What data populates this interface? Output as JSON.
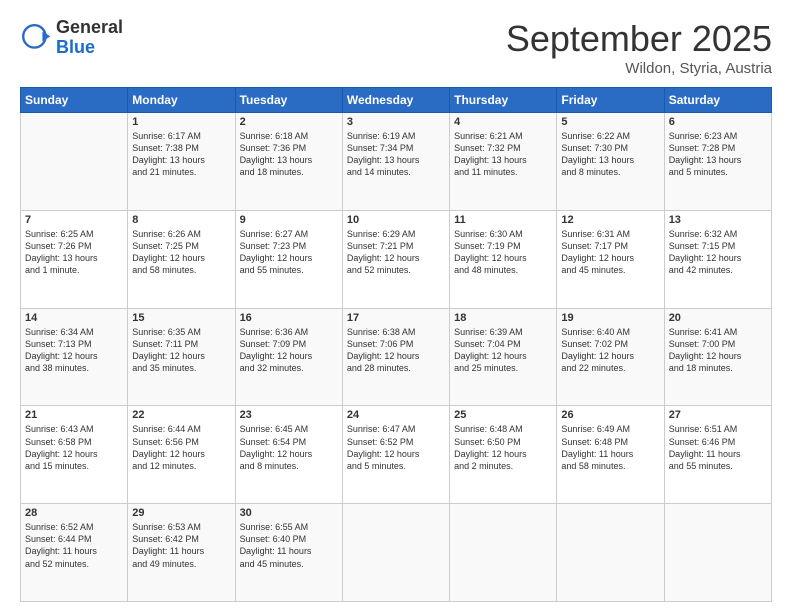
{
  "header": {
    "logo_general": "General",
    "logo_blue": "Blue",
    "month": "September 2025",
    "location": "Wildon, Styria, Austria"
  },
  "days_of_week": [
    "Sunday",
    "Monday",
    "Tuesday",
    "Wednesday",
    "Thursday",
    "Friday",
    "Saturday"
  ],
  "weeks": [
    [
      {
        "day": "",
        "info": ""
      },
      {
        "day": "1",
        "info": "Sunrise: 6:17 AM\nSunset: 7:38 PM\nDaylight: 13 hours\nand 21 minutes."
      },
      {
        "day": "2",
        "info": "Sunrise: 6:18 AM\nSunset: 7:36 PM\nDaylight: 13 hours\nand 18 minutes."
      },
      {
        "day": "3",
        "info": "Sunrise: 6:19 AM\nSunset: 7:34 PM\nDaylight: 13 hours\nand 14 minutes."
      },
      {
        "day": "4",
        "info": "Sunrise: 6:21 AM\nSunset: 7:32 PM\nDaylight: 13 hours\nand 11 minutes."
      },
      {
        "day": "5",
        "info": "Sunrise: 6:22 AM\nSunset: 7:30 PM\nDaylight: 13 hours\nand 8 minutes."
      },
      {
        "day": "6",
        "info": "Sunrise: 6:23 AM\nSunset: 7:28 PM\nDaylight: 13 hours\nand 5 minutes."
      }
    ],
    [
      {
        "day": "7",
        "info": "Sunrise: 6:25 AM\nSunset: 7:26 PM\nDaylight: 13 hours\nand 1 minute."
      },
      {
        "day": "8",
        "info": "Sunrise: 6:26 AM\nSunset: 7:25 PM\nDaylight: 12 hours\nand 58 minutes."
      },
      {
        "day": "9",
        "info": "Sunrise: 6:27 AM\nSunset: 7:23 PM\nDaylight: 12 hours\nand 55 minutes."
      },
      {
        "day": "10",
        "info": "Sunrise: 6:29 AM\nSunset: 7:21 PM\nDaylight: 12 hours\nand 52 minutes."
      },
      {
        "day": "11",
        "info": "Sunrise: 6:30 AM\nSunset: 7:19 PM\nDaylight: 12 hours\nand 48 minutes."
      },
      {
        "day": "12",
        "info": "Sunrise: 6:31 AM\nSunset: 7:17 PM\nDaylight: 12 hours\nand 45 minutes."
      },
      {
        "day": "13",
        "info": "Sunrise: 6:32 AM\nSunset: 7:15 PM\nDaylight: 12 hours\nand 42 minutes."
      }
    ],
    [
      {
        "day": "14",
        "info": "Sunrise: 6:34 AM\nSunset: 7:13 PM\nDaylight: 12 hours\nand 38 minutes."
      },
      {
        "day": "15",
        "info": "Sunrise: 6:35 AM\nSunset: 7:11 PM\nDaylight: 12 hours\nand 35 minutes."
      },
      {
        "day": "16",
        "info": "Sunrise: 6:36 AM\nSunset: 7:09 PM\nDaylight: 12 hours\nand 32 minutes."
      },
      {
        "day": "17",
        "info": "Sunrise: 6:38 AM\nSunset: 7:06 PM\nDaylight: 12 hours\nand 28 minutes."
      },
      {
        "day": "18",
        "info": "Sunrise: 6:39 AM\nSunset: 7:04 PM\nDaylight: 12 hours\nand 25 minutes."
      },
      {
        "day": "19",
        "info": "Sunrise: 6:40 AM\nSunset: 7:02 PM\nDaylight: 12 hours\nand 22 minutes."
      },
      {
        "day": "20",
        "info": "Sunrise: 6:41 AM\nSunset: 7:00 PM\nDaylight: 12 hours\nand 18 minutes."
      }
    ],
    [
      {
        "day": "21",
        "info": "Sunrise: 6:43 AM\nSunset: 6:58 PM\nDaylight: 12 hours\nand 15 minutes."
      },
      {
        "day": "22",
        "info": "Sunrise: 6:44 AM\nSunset: 6:56 PM\nDaylight: 12 hours\nand 12 minutes."
      },
      {
        "day": "23",
        "info": "Sunrise: 6:45 AM\nSunset: 6:54 PM\nDaylight: 12 hours\nand 8 minutes."
      },
      {
        "day": "24",
        "info": "Sunrise: 6:47 AM\nSunset: 6:52 PM\nDaylight: 12 hours\nand 5 minutes."
      },
      {
        "day": "25",
        "info": "Sunrise: 6:48 AM\nSunset: 6:50 PM\nDaylight: 12 hours\nand 2 minutes."
      },
      {
        "day": "26",
        "info": "Sunrise: 6:49 AM\nSunset: 6:48 PM\nDaylight: 11 hours\nand 58 minutes."
      },
      {
        "day": "27",
        "info": "Sunrise: 6:51 AM\nSunset: 6:46 PM\nDaylight: 11 hours\nand 55 minutes."
      }
    ],
    [
      {
        "day": "28",
        "info": "Sunrise: 6:52 AM\nSunset: 6:44 PM\nDaylight: 11 hours\nand 52 minutes."
      },
      {
        "day": "29",
        "info": "Sunrise: 6:53 AM\nSunset: 6:42 PM\nDaylight: 11 hours\nand 49 minutes."
      },
      {
        "day": "30",
        "info": "Sunrise: 6:55 AM\nSunset: 6:40 PM\nDaylight: 11 hours\nand 45 minutes."
      },
      {
        "day": "",
        "info": ""
      },
      {
        "day": "",
        "info": ""
      },
      {
        "day": "",
        "info": ""
      },
      {
        "day": "",
        "info": ""
      }
    ]
  ]
}
